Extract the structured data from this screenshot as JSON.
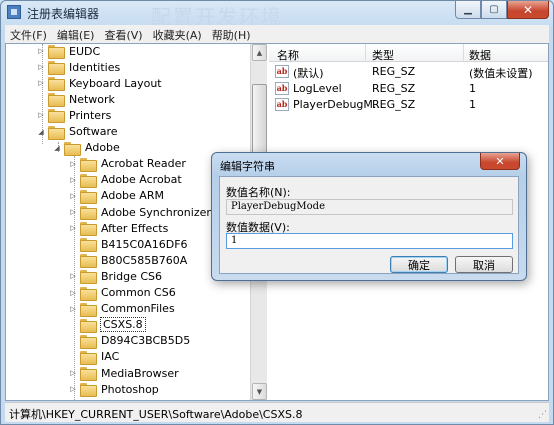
{
  "window": {
    "title": "注册表编辑器",
    "watermark": "配置开发环境",
    "minimize_label": "▁",
    "maximize_label": "▢",
    "close_label": "✕"
  },
  "menu": [
    "文件(F)",
    "编辑(E)",
    "查看(V)",
    "收藏夹(A)",
    "帮助(H)"
  ],
  "tree": {
    "items": [
      {
        "label": "EUDC",
        "depth": 2,
        "toggle": "▷"
      },
      {
        "label": "Identities",
        "depth": 2,
        "toggle": "▷"
      },
      {
        "label": "Keyboard Layout",
        "depth": 2,
        "toggle": "▷"
      },
      {
        "label": "Network",
        "depth": 2,
        "toggle": ""
      },
      {
        "label": "Printers",
        "depth": 2,
        "toggle": "▷"
      },
      {
        "label": "Software",
        "depth": 2,
        "toggle": "◢"
      },
      {
        "label": "Adobe",
        "depth": 3,
        "toggle": "◢"
      },
      {
        "label": "Acrobat Reader",
        "depth": 4,
        "toggle": "▷"
      },
      {
        "label": "Adobe Acrobat",
        "depth": 4,
        "toggle": "▷"
      },
      {
        "label": "Adobe ARM",
        "depth": 4,
        "toggle": "▷"
      },
      {
        "label": "Adobe Synchronizer",
        "depth": 4,
        "toggle": "▷"
      },
      {
        "label": "After Effects",
        "depth": 4,
        "toggle": "▷"
      },
      {
        "label": "B415C0A16DF6",
        "depth": 4,
        "toggle": ""
      },
      {
        "label": "B80C585B760A",
        "depth": 4,
        "toggle": ""
      },
      {
        "label": "Bridge CS6",
        "depth": 4,
        "toggle": "▷"
      },
      {
        "label": "Common CS6",
        "depth": 4,
        "toggle": "▷"
      },
      {
        "label": "CommonFiles",
        "depth": 4,
        "toggle": "▷"
      },
      {
        "label": "CSXS.8",
        "depth": 4,
        "toggle": "",
        "selected": true
      },
      {
        "label": "D894C3BCB5D5",
        "depth": 4,
        "toggle": ""
      },
      {
        "label": "IAC",
        "depth": 4,
        "toggle": ""
      },
      {
        "label": "MediaBrowser",
        "depth": 4,
        "toggle": "▷"
      },
      {
        "label": "Photoshop",
        "depth": 4,
        "toggle": "▷"
      }
    ]
  },
  "list": {
    "columns": [
      "名称",
      "类型",
      "数据"
    ],
    "rows": [
      {
        "name": "(默认)",
        "type": "REG_SZ",
        "data": "(数值未设置)",
        "icon": "ab"
      },
      {
        "name": "LogLevel",
        "type": "REG_SZ",
        "data": "1",
        "icon": "ab"
      },
      {
        "name": "PlayerDebugM...",
        "type": "REG_SZ",
        "data": "1",
        "icon": "ab"
      }
    ]
  },
  "status": {
    "path": "计算机\\HKEY_CURRENT_USER\\Software\\Adobe\\CSXS.8"
  },
  "dialog": {
    "title": "编辑字符串",
    "name_label": "数值名称(N):",
    "name_value": "PlayerDebugMode",
    "data_label": "数值数据(V):",
    "data_value": "1",
    "ok_label": "确定",
    "cancel_label": "取消",
    "close_label": "✕"
  },
  "colors": {
    "title_bar": "#c4daf0",
    "close_button": "#c7452c",
    "folder": "#e8bd52"
  }
}
